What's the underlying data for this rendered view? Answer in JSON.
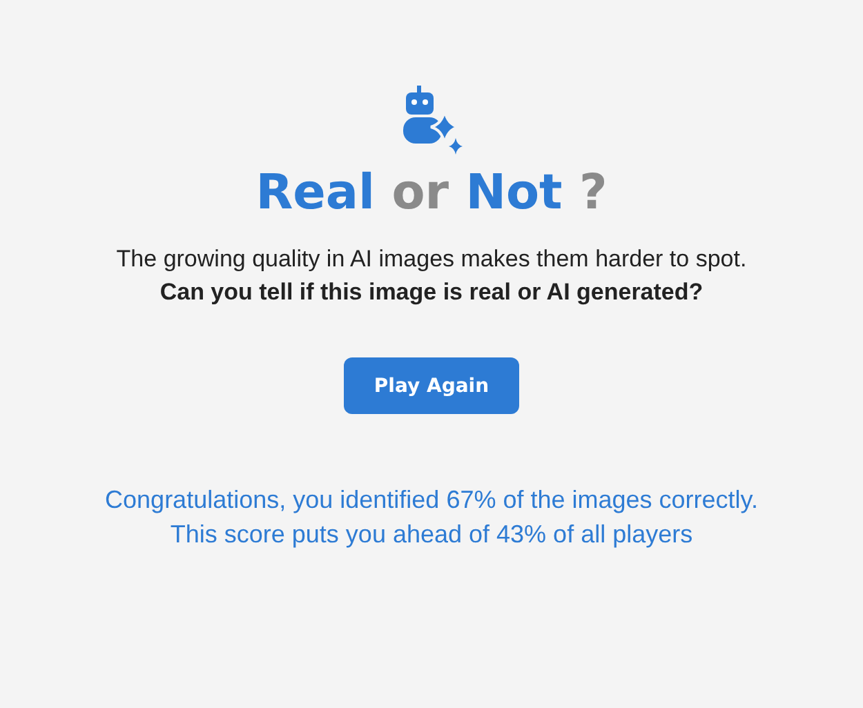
{
  "title": {
    "word_1": "Real",
    "word_2": "or",
    "word_3": "Not",
    "mark": "?"
  },
  "intro": "The growing quality in AI images makes them harder to spot.",
  "question": "Can you tell if this image is real or AI generated?",
  "button": "Play Again",
  "result": [
    "Congratulations, you identified 67% of the images correctly.",
    "This score puts you ahead of 43% of all players"
  ]
}
